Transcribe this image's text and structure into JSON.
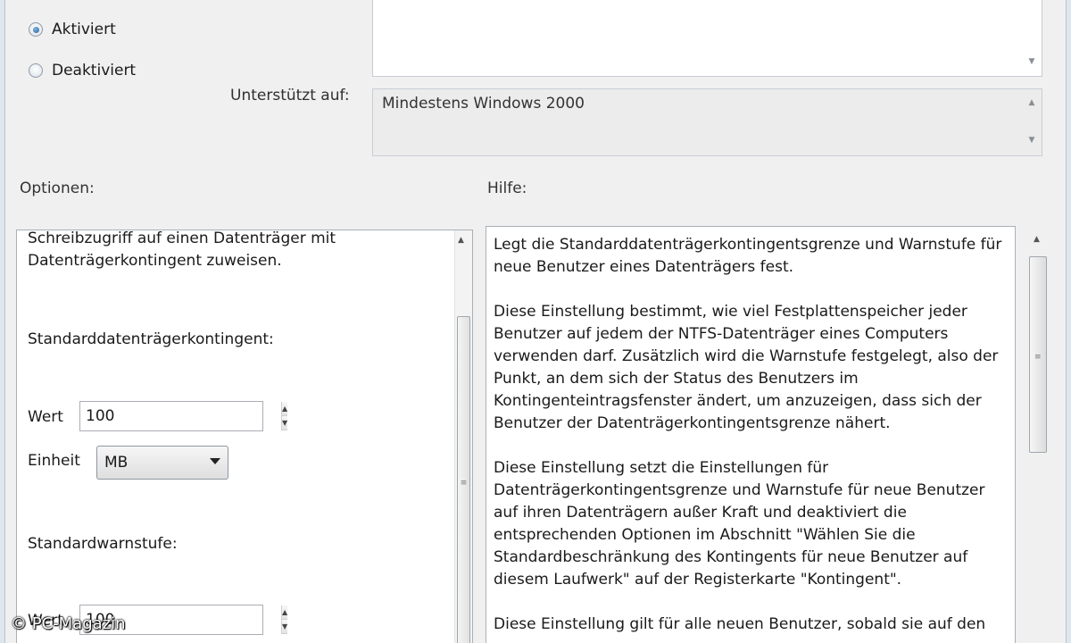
{
  "state": {
    "enabled_label": "Aktiviert",
    "disabled_label": "Deaktiviert",
    "selected": "Aktiviert"
  },
  "supported": {
    "label": "Unterstützt auf:",
    "value": "Mindestens Windows 2000"
  },
  "sections": {
    "options_label": "Optionen:",
    "help_label": "Hilfe:"
  },
  "options": {
    "intro_line1": "Schreibzugriff auf einen Datenträger mit",
    "intro_line2": "Datenträgerkontingent zuweisen.",
    "quota_heading": "Standarddatenträgerkontingent:",
    "value_label": "Wert",
    "quota_value": "100",
    "unit_label": "Einheit",
    "unit_selected": "MB",
    "warning_heading": "Standardwarnstufe:",
    "warning_value_label": "Wert",
    "warning_value": "100"
  },
  "help": {
    "paragraphs": [
      "Legt die Standarddatenträgerkontingentsgrenze und Warnstufe für neue Benutzer eines Datenträgers fest.",
      "Diese Einstellung bestimmt, wie viel Festplattenspeicher jeder Benutzer auf jedem der NTFS-Datenträger eines Computers verwenden darf. Zusätzlich wird die Warnstufe festgelegt, also der Punkt, an dem sich der Status des Benutzers im Kontingenteintragsfenster ändert, um anzuzeigen, dass sich der Benutzer der Datenträgerkontingentsgrenze nähert.",
      "Diese Einstellung setzt die Einstellungen für Datenträgerkontingentsgrenze und Warnstufe für neue Benutzer auf ihren Datenträgern außer Kraft und deaktiviert die entsprechenden Optionen im Abschnitt \"Wählen Sie die Standardbeschränkung des Kontingents für neue Benutzer auf diesem Laufwerk\" auf der Registerkarte \"Kontingent\".",
      "Diese Einstellung gilt für alle neuen Benutzer, sobald sie auf den"
    ]
  },
  "watermark": "© PC-Magazin"
}
